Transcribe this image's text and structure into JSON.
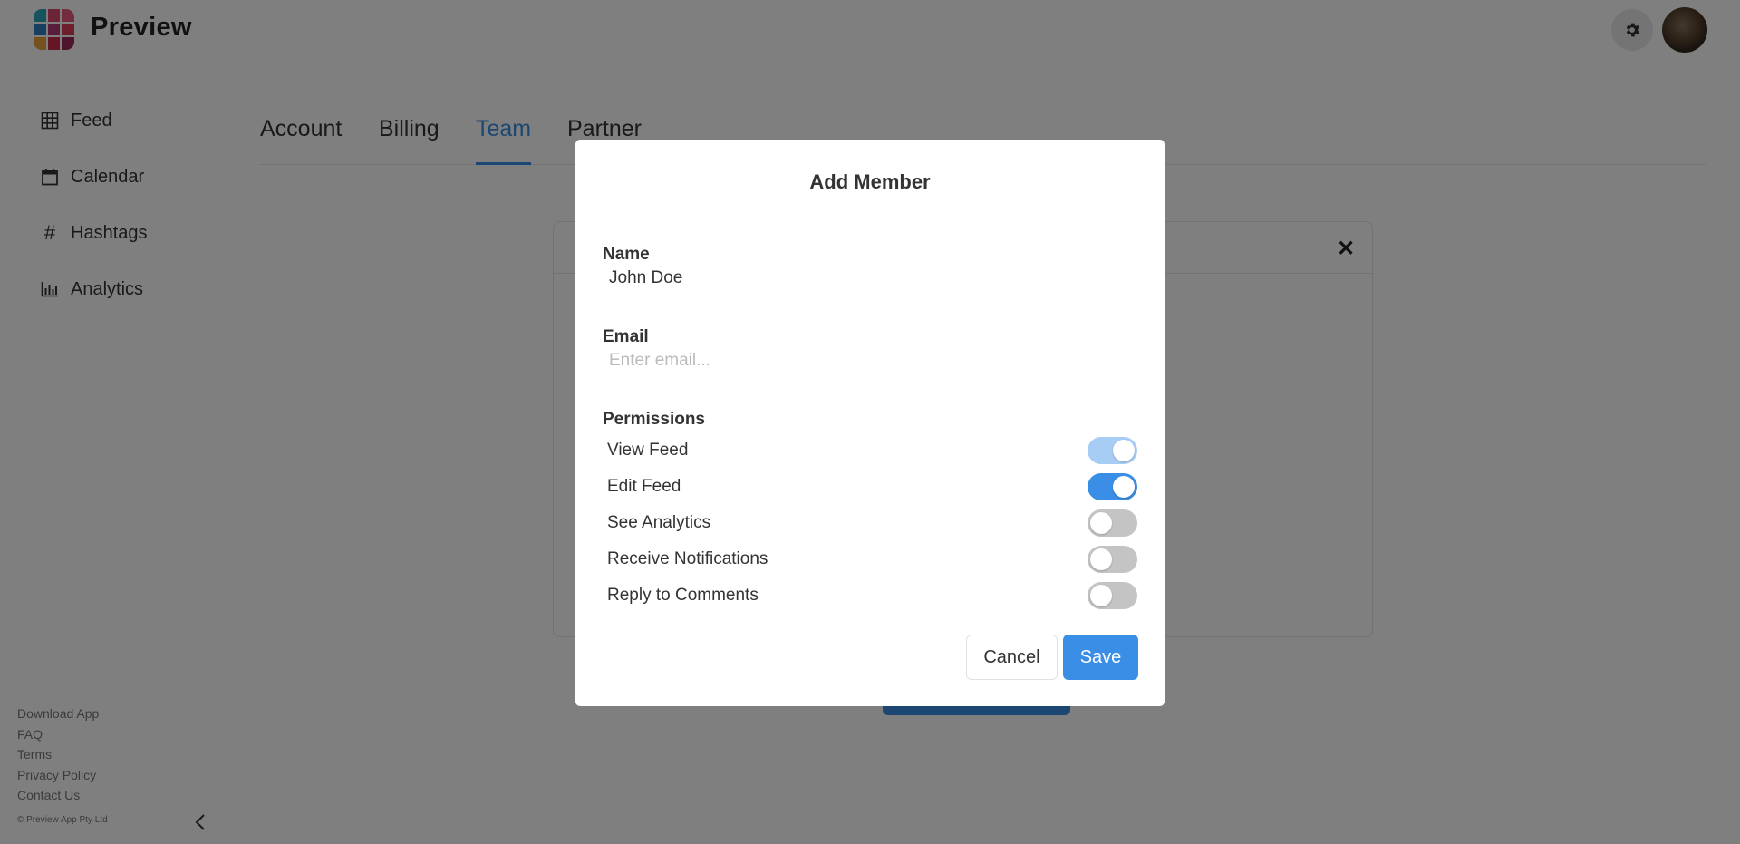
{
  "header": {
    "app_title": "Preview",
    "logo_colors": [
      "#2fa6b8",
      "#d84a6b",
      "#e85b7f",
      "#2e7fc0",
      "#b23a78",
      "#d93c59",
      "#e8a23a",
      "#c92c4a",
      "#9c2858"
    ],
    "icons": {
      "settings": "gear-icon",
      "avatar": "avatar"
    }
  },
  "sidebar": {
    "items": [
      {
        "label": "Feed",
        "icon": "grid-icon"
      },
      {
        "label": "Calendar",
        "icon": "calendar-icon"
      },
      {
        "label": "Hashtags",
        "icon": "hashtag-icon"
      },
      {
        "label": "Analytics",
        "icon": "bar-chart-icon"
      }
    ],
    "footer_links": [
      "Download App",
      "FAQ",
      "Terms",
      "Privacy Policy",
      "Contact Us"
    ],
    "copyright": "© Preview App Pty Ltd"
  },
  "tabs": {
    "items": [
      "Account",
      "Billing",
      "Team",
      "Partner"
    ],
    "active": "Team"
  },
  "modal": {
    "title": "Add Member",
    "name_label": "Name",
    "name_value": "John Doe",
    "email_label": "Email",
    "email_value": "",
    "email_placeholder": "Enter email...",
    "permissions_label": "Permissions",
    "permissions": [
      {
        "label": "View Feed",
        "enabled": true,
        "disabled_control": true
      },
      {
        "label": "Edit Feed",
        "enabled": true,
        "disabled_control": false
      },
      {
        "label": "See Analytics",
        "enabled": false,
        "disabled_control": false
      },
      {
        "label": "Receive Notifications",
        "enabled": false,
        "disabled_control": false
      },
      {
        "label": "Reply to Comments",
        "enabled": false,
        "disabled_control": false
      }
    ],
    "cancel_label": "Cancel",
    "save_label": "Save"
  },
  "colors": {
    "accent": "#3a8ee6",
    "overlay": "rgba(0,0,0,0.5)"
  }
}
